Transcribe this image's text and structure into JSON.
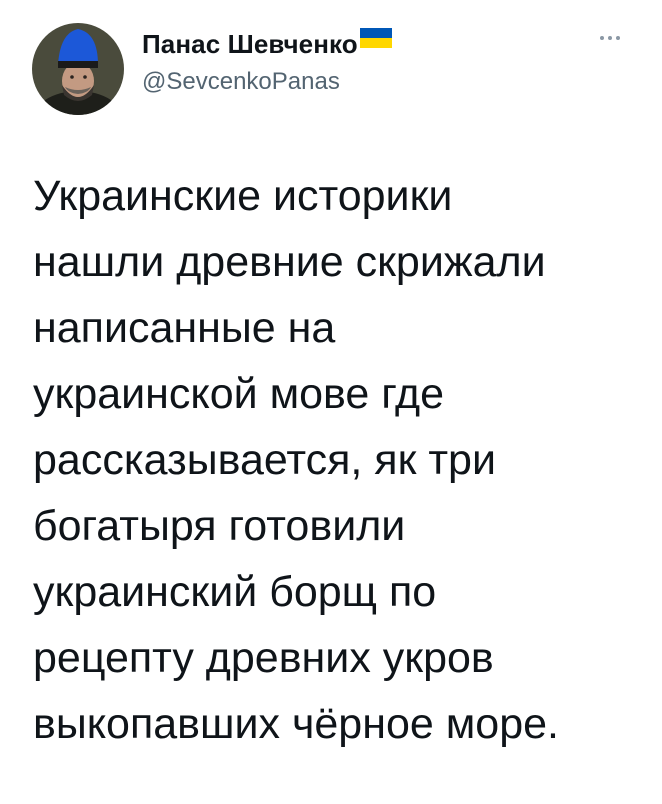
{
  "author": {
    "display_name": "Панас Шевченко",
    "handle": "@SevcenkoPanas",
    "avatar_icon": "profile-portrait-avatar",
    "badge_icon": "ukraine-flag-icon",
    "flag_colors": [
      "#0057b7",
      "#ffd700"
    ]
  },
  "menu": {
    "icon": "more-options-icon"
  },
  "tweet": {
    "lines": [
      "Украинские историки",
      "нашли древние скрижали",
      "написанные на",
      "украинской мове где",
      "рассказывается, як три",
      "богатыря готовили",
      "украинский борщ по",
      "рецепту древних укров",
      "выкопавших чёрное море."
    ]
  }
}
